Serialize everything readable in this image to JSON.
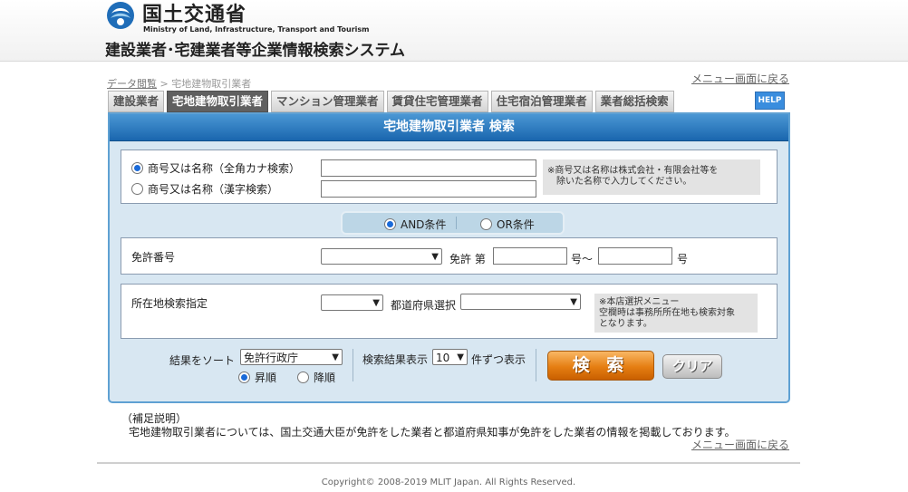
{
  "header": {
    "ministry_name": "国土交通省",
    "ministry_name_en": "Ministry of Land, Infrastructure, Transport and Tourism",
    "system_title": "建設業者･宅建業者等企業情報検索システム"
  },
  "breadcrumb": {
    "root": "データ閲覧",
    "separator": ">",
    "current": "宅地建物取引業者"
  },
  "menu_back_label": "メニュー画面に戻る",
  "tabs": [
    {
      "label": "建設業者",
      "active": false
    },
    {
      "label": "宅地建物取引業者",
      "active": true
    },
    {
      "label": "マンション管理業者",
      "active": false
    },
    {
      "label": "賃貸住宅管理業者",
      "active": false
    },
    {
      "label": "住宅宿泊管理業者",
      "active": false
    },
    {
      "label": "業者総括検索",
      "active": false
    }
  ],
  "help_label": "HELP",
  "panel_title": "宅地建物取引業者 検索",
  "name_search": {
    "option_kana": "商号又は名称（全角カナ検索）",
    "option_kanji": "商号又は名称（漢字検索）",
    "selected": "kana",
    "kana_value": "",
    "kanji_value": "",
    "note": "※商号又は名称は株式会社・有限会社等を\n　除いた名称で入力してください。"
  },
  "condition": {
    "and_label": "AND条件",
    "or_label": "OR条件",
    "selected": "and"
  },
  "license": {
    "label": "免許番号",
    "authority_value": "",
    "license_prefix": "免許 第",
    "from_value": "",
    "range_sep": "号～",
    "to_value": "",
    "suffix": "号"
  },
  "location": {
    "label": "所在地検索指定",
    "type_value": "",
    "prefecture_label": "都道府県選択",
    "prefecture_value": "",
    "note": "※本店選択メニュー\n空欄時は事務所所在地も検索対象\nとなります。"
  },
  "sort": {
    "label": "結果をソート",
    "value": "免許行政庁",
    "asc_label": "昇順",
    "desc_label": "降順",
    "order": "asc"
  },
  "page_size": {
    "prefix": "検索結果表示",
    "value": "10",
    "suffix": "件ずつ表示"
  },
  "buttons": {
    "search": "検 索",
    "clear": "クリア"
  },
  "supplement": {
    "title": "（補足説明）",
    "text": "宅地建物取引業者については、国土交通大臣が免許をした業者と都道府県知事が免許をした業者の情報を掲載しております。"
  },
  "copyright": "Copyright© 2008-2019 MLIT Japan. All Rights Reserved."
}
